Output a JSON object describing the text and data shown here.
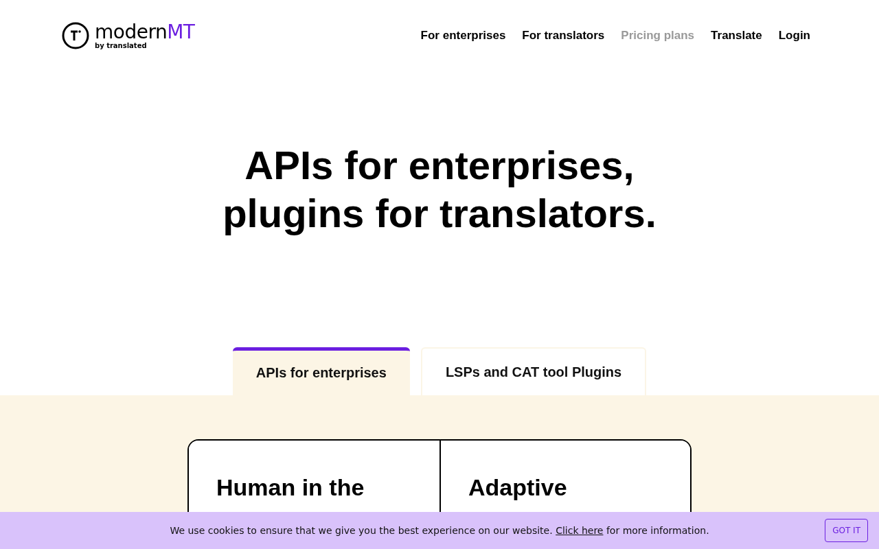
{
  "header": {
    "logo": {
      "name": "modern",
      "accent": "MT",
      "tagline": "by translated"
    },
    "nav": [
      {
        "label": "For enterprises",
        "muted": false
      },
      {
        "label": "For translators",
        "muted": false
      },
      {
        "label": "Pricing plans",
        "muted": true
      },
      {
        "label": "Translate",
        "muted": false
      },
      {
        "label": "Login",
        "muted": false
      }
    ]
  },
  "hero": {
    "title": "APIs for enterprises, plugins for translators."
  },
  "tabs": [
    {
      "label": "APIs for enterprises",
      "selected": true
    },
    {
      "label": "LSPs and CAT tool Plugins",
      "selected": false
    }
  ],
  "cards": [
    {
      "title": "Human in the"
    },
    {
      "title": "Adaptive"
    }
  ],
  "cookie_banner": {
    "text_before": "We use cookies to ensure that we give you the best experience on our website.",
    "link": "Click here",
    "text_after": "for more information.",
    "button": "GOT IT"
  }
}
